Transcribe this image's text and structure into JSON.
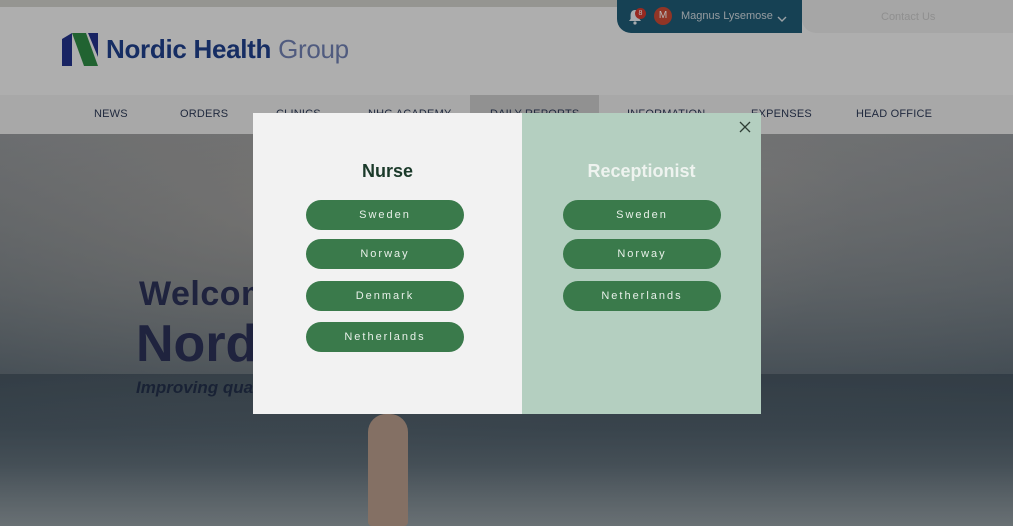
{
  "header": {
    "logo_text": "Nordic Health",
    "logo_text_suffix": "Group",
    "user": {
      "notification_count": "8",
      "avatar_initial": "M",
      "name": "Magnus Lysemose"
    },
    "contact_label": "Contact Us"
  },
  "nav": {
    "items": [
      "NEWS",
      "ORDERS",
      "CLINICS",
      "NHG ACADEMY",
      "DAILY REPORTS",
      "INFORMATION",
      "EXPENSES",
      "HEAD OFFICE"
    ]
  },
  "hero": {
    "line1": "Welcom",
    "line2": "Nord",
    "line3": "Improving quali"
  },
  "modal": {
    "nurse": {
      "title": "Nurse",
      "buttons": [
        "Sweden",
        "Norway",
        "Denmark",
        "Netherlands"
      ]
    },
    "receptionist": {
      "title": "Receptionist",
      "buttons": [
        "Sweden",
        "Norway",
        "Netherlands"
      ]
    }
  },
  "colors": {
    "brand_navy": "#1f3f8a",
    "button_green": "#3a7a4b",
    "receptionist_panel": "#b4cfc0",
    "user_bar": "#1f5a75"
  },
  "icons": [
    "logo-mark-icon",
    "bell-icon",
    "chevron-down-icon",
    "close-icon"
  ]
}
